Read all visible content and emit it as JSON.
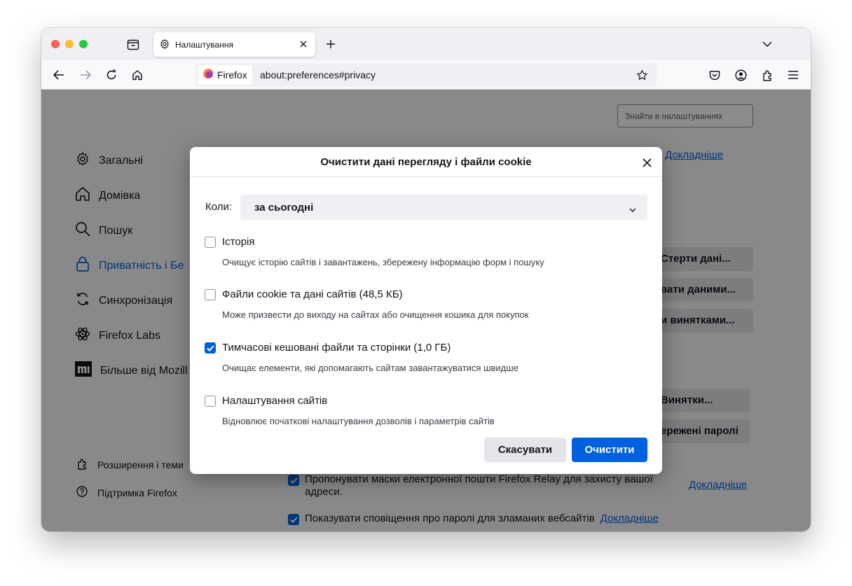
{
  "tab": {
    "title": "Налаштування",
    "icon": "gear-icon"
  },
  "navbar": {
    "identity_label": "Firefox",
    "url": "about:preferences#privacy"
  },
  "prefs": {
    "search_placeholder": "Знайти в налаштуваннях",
    "sidebar": [
      {
        "icon": "gear-icon",
        "label": "Загальні"
      },
      {
        "icon": "home-icon",
        "label": "Домівка"
      },
      {
        "icon": "search-icon",
        "label": "Пошук"
      },
      {
        "icon": "lock-icon",
        "label": "Приватність і Бе"
      },
      {
        "icon": "sync-icon",
        "label": "Синхронізація"
      },
      {
        "icon": "labs-icon",
        "label": "Firefox Labs"
      },
      {
        "icon": "mozilla-icon",
        "label": "Більше від Mozill"
      }
    ],
    "sidebar_bottom": [
      {
        "icon": "extensions-icon",
        "label": "Розширення і теми"
      },
      {
        "icon": "help-icon",
        "label": "Підтримка Firefox"
      }
    ],
    "bg_link_top": "Докладніше",
    "bg_buttons": [
      "Стерти дані...",
      "вати даними...",
      "и винятками...",
      "Винятки...",
      "ережені паролі"
    ],
    "bg_checks": [
      {
        "label": "Пропонувати маски електронної пошти Firefox Relay для захисту вашої адреси.",
        "link": "Докладніше"
      },
      {
        "label": "Показувати сповіщення про паролі для зламаних вебсайтів",
        "link": "Докладніше"
      }
    ]
  },
  "dialog": {
    "title": "Очистити дані перегляду і файли cookie",
    "when_label": "Коли:",
    "when_value": "за сьогодні",
    "options": [
      {
        "label": "Історія",
        "desc": "Очищує історію сайтів і завантажень, збережену інформацію форм і пошуку",
        "checked": false
      },
      {
        "label": "Файли cookie та дані сайтів (48,5 КБ)",
        "desc": "Може призвести до виходу на сайтах або очищення кошика для покупок",
        "checked": false
      },
      {
        "label": "Тимчасові кешовані файли та сторінки (1,0 ГБ)",
        "desc": "Очищає елементи, які допомагають сайтам завантажуватися швидше",
        "checked": true
      },
      {
        "label": "Налаштування сайтів",
        "desc": "Відновлює початкові налаштування дозволів і параметрів сайтів",
        "checked": false
      }
    ],
    "cancel_label": "Скасувати",
    "clear_label": "Очистити"
  },
  "colors": {
    "accent": "#0061e0",
    "overlay": "rgba(0,0,0,0.45)"
  }
}
